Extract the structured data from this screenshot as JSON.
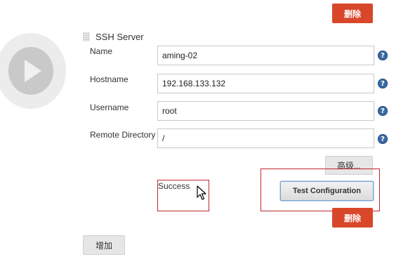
{
  "top_delete_label": "删除",
  "section_title": "SSH Server",
  "fields": [
    {
      "label": "Name",
      "value": "aming-02"
    },
    {
      "label": "Hostname",
      "value": "192.168.133.132"
    },
    {
      "label": "Username",
      "value": "root"
    },
    {
      "label": "Remote Directory",
      "value": "/"
    }
  ],
  "help_glyph": "?",
  "advanced_label": "高级...",
  "status_text": "Success",
  "test_button_label": "Test Configuration",
  "bottom_delete_label": "删除",
  "add_label": "增加",
  "colors": {
    "delete": "#d9472b",
    "help": "#3b6aa6",
    "highlight_box": "#c2262f"
  }
}
